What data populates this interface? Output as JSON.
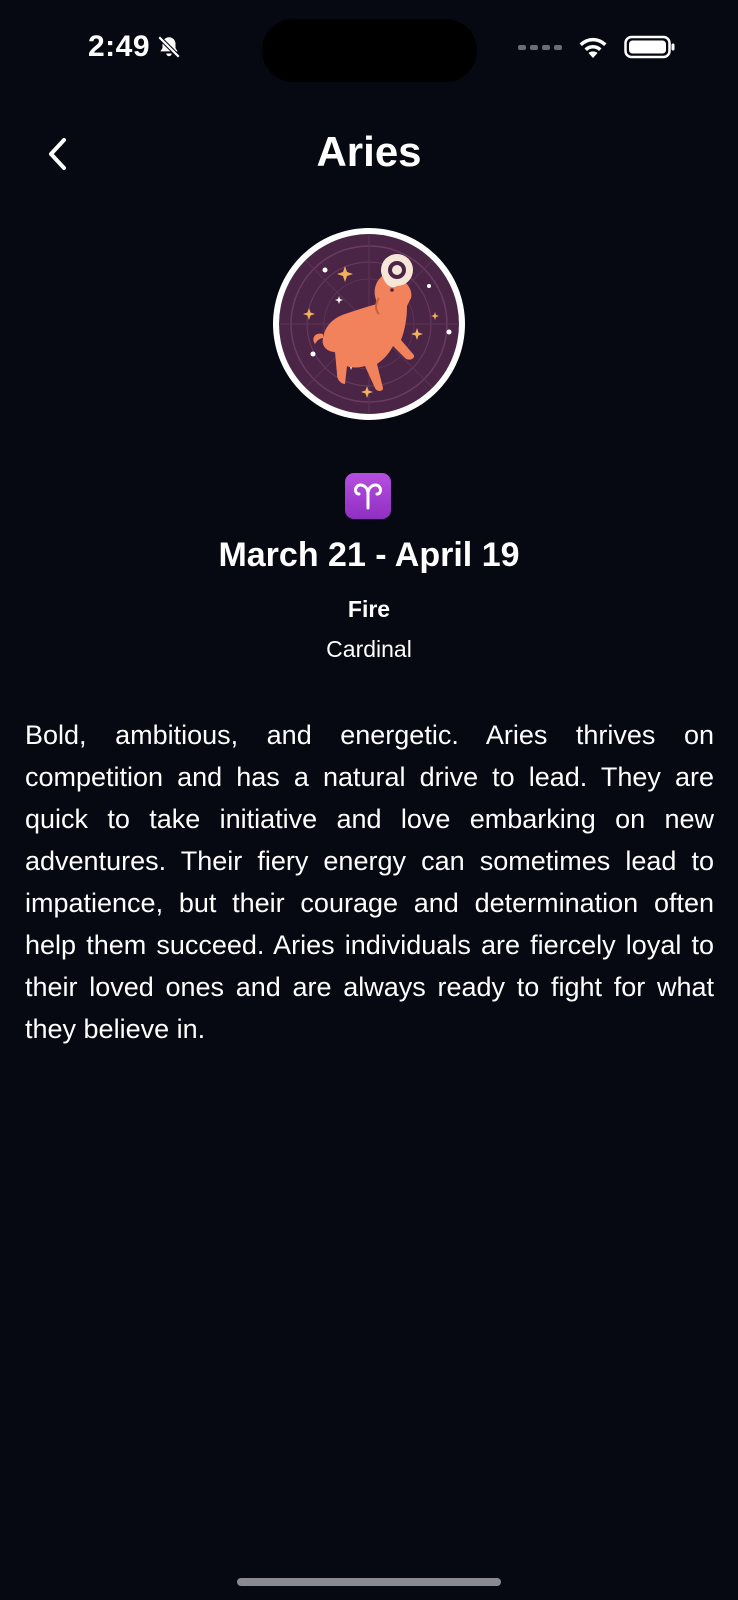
{
  "status_bar": {
    "time": "2:49",
    "icons": [
      "bell-slash-icon",
      "cellular-signal-icon",
      "wifi-icon",
      "battery-icon"
    ]
  },
  "nav": {
    "title": "Aries",
    "back_icon": "chevron-left-icon"
  },
  "sign": {
    "image": "ram-zodiac-illustration",
    "symbol": "♈",
    "symbol_icon": "aries-symbol-icon",
    "dates": "March 21 - April 19",
    "element": "Fire",
    "modality": "Cardinal",
    "description": "Bold, ambitious, and energetic. Aries thrives on competition and has a natural drive to lead. They are quick to take initiative and love embarking on new adventures. Their fiery energy can sometimes lead to impatience, but their courage and determination often help them succeed. Aries individuals are fiercely loyal to their loved ones and are always ready to fight for what they believe in."
  },
  "colors": {
    "background": "#060812",
    "text": "#ffffff",
    "avatar_fill": "#4a2545",
    "ram": "#f2825c",
    "symbol_badge": "#a93ed6"
  }
}
